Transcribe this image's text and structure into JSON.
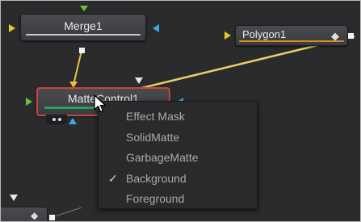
{
  "nodes": {
    "merge": {
      "label": "Merge1"
    },
    "polygon": {
      "label": "Polygon1",
      "icon": "diamond-icon"
    },
    "matte_control": {
      "label": "MatteControl1",
      "selected": true
    }
  },
  "context_menu": {
    "items": [
      {
        "label": "Effect Mask",
        "checked": false
      },
      {
        "label": "SolidMatte",
        "checked": false
      },
      {
        "label": "GarbageMatte",
        "checked": false
      },
      {
        "label": "Background",
        "checked": true
      },
      {
        "label": "Foreground",
        "checked": false
      }
    ],
    "check_glyph": "✓"
  },
  "colors": {
    "canvas": "#2b2b2d",
    "node_fill": "#3f4044",
    "selection_outline": "#c6463b",
    "connection_line": "#e9cc6a",
    "merge_input": "#e9c52a",
    "mask_input": "#38a8e6",
    "matte_bar": "#26a45f",
    "polygon_bar": "#d38a1f"
  }
}
